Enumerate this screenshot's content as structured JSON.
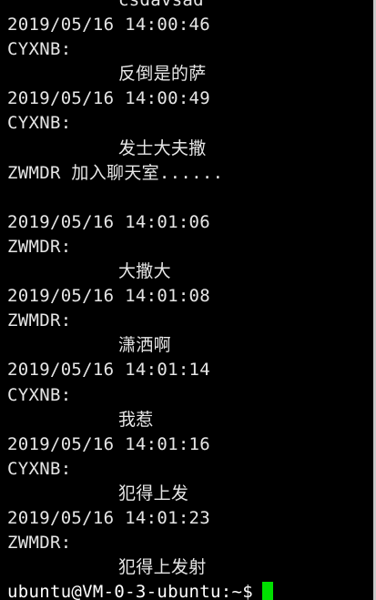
{
  "theme": {
    "background": "#000000",
    "text": "#e6e6e6",
    "cursor": "#00e000"
  },
  "terminal": {
    "lines": [
      {
        "kind": "msg",
        "text": "csdavsad"
      },
      {
        "kind": "time",
        "text": "2019/05/16 14:00:46"
      },
      {
        "kind": "user",
        "text": "CYXNB:"
      },
      {
        "kind": "msg",
        "text": "反倒是的萨"
      },
      {
        "kind": "time",
        "text": "2019/05/16 14:00:49"
      },
      {
        "kind": "user",
        "text": "CYXNB:"
      },
      {
        "kind": "msg",
        "text": "发士大夫撒"
      },
      {
        "kind": "system",
        "text": "ZWMDR 加入聊天室......"
      },
      {
        "kind": "blank",
        "text": ""
      },
      {
        "kind": "time",
        "text": "2019/05/16 14:01:06"
      },
      {
        "kind": "user",
        "text": "ZWMDR:"
      },
      {
        "kind": "msg",
        "text": "大撒大"
      },
      {
        "kind": "time",
        "text": "2019/05/16 14:01:08"
      },
      {
        "kind": "user",
        "text": "ZWMDR:"
      },
      {
        "kind": "msg",
        "text": "潇洒啊"
      },
      {
        "kind": "time",
        "text": "2019/05/16 14:01:14"
      },
      {
        "kind": "user",
        "text": "CYXNB:"
      },
      {
        "kind": "msg",
        "text": "我惹"
      },
      {
        "kind": "time",
        "text": "2019/05/16 14:01:16"
      },
      {
        "kind": "user",
        "text": "CYXNB:"
      },
      {
        "kind": "msg",
        "text": "犯得上发"
      },
      {
        "kind": "time",
        "text": "2019/05/16 14:01:23"
      },
      {
        "kind": "user",
        "text": "ZWMDR:"
      },
      {
        "kind": "msg",
        "text": "犯得上发射"
      }
    ],
    "prompt": "ubuntu@VM-0-3-ubuntu:~$"
  }
}
